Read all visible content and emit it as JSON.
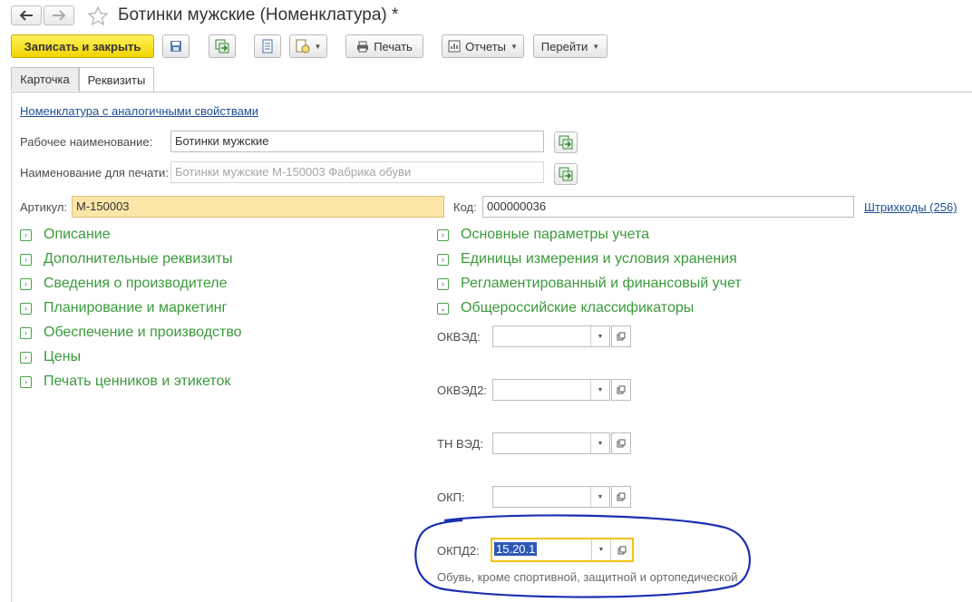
{
  "window": {
    "title": "Ботинки мужские (Номенклатура) *"
  },
  "toolbar": {
    "save_close": "Записать и закрыть",
    "print": "Печать",
    "reports": "Отчеты",
    "goto": "Перейти"
  },
  "tabs": [
    {
      "label": "Карточка"
    },
    {
      "label": "Реквизиты"
    }
  ],
  "form": {
    "similar_link": "Номенклатура с аналогичными свойствами",
    "work_name_label": "Рабочее наименование:",
    "work_name_value": "Ботинки мужские",
    "print_name_label": "Наименование для печати:",
    "print_name_value": "Ботинки мужские М-150003 Фабрика обуви",
    "article_label": "Артикул:",
    "article_value": "М-150003",
    "code_label": "Код:",
    "code_value": "000000036",
    "barcodes_link": "Штрихкоды (256)"
  },
  "left_groups": [
    {
      "label": "Описание"
    },
    {
      "label": "Дополнительные реквизиты"
    },
    {
      "label": "Сведения о производителе"
    },
    {
      "label": "Планирование и маркетинг"
    },
    {
      "label": "Обеспечение и производство"
    },
    {
      "label": "Цены"
    },
    {
      "label": "Печать ценников и этикеток"
    }
  ],
  "right_groups": [
    {
      "label": "Основные параметры учета"
    },
    {
      "label": "Единицы измерения и условия хранения"
    },
    {
      "label": "Регламентированный и финансовый учет"
    },
    {
      "label": "Общероссийские классификаторы"
    }
  ],
  "classifiers": [
    {
      "label": "ОКВЭД:",
      "value": ""
    },
    {
      "label": "ОКВЭД2:",
      "value": ""
    },
    {
      "label": "ТН ВЭД:",
      "value": ""
    },
    {
      "label": "ОКП:",
      "value": ""
    },
    {
      "label": "ОКПД2:",
      "value": "15.20.1"
    }
  ],
  "okpd2_description": "Обувь, кроме спортивной, защитной и ортопедической",
  "colors": {
    "accent_yellow": "#f1d400",
    "group_green": "#3a9a3a",
    "link_blue": "#1f4f8f",
    "annotation_blue": "#1a2fb0"
  }
}
